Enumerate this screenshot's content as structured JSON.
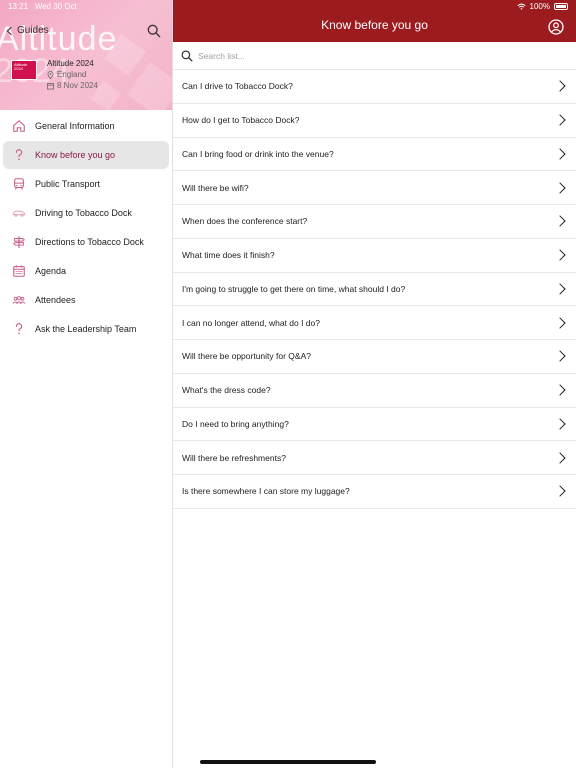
{
  "status": {
    "time": "13:21",
    "date": "Wed 30 Oct",
    "battery": "100%"
  },
  "sidebar": {
    "back_label": "Guides",
    "hero_word": "Altitude",
    "hero_year": "2024",
    "logo_text": "Altitude 2024",
    "event_name": "Altitude 2024",
    "event_location": "England",
    "event_date": "8 Nov 2024",
    "items": [
      {
        "label": "General Information",
        "icon": "home-icon"
      },
      {
        "label": "Know before you go",
        "icon": "question-icon",
        "active": true
      },
      {
        "label": "Public Transport",
        "icon": "bus-icon"
      },
      {
        "label": "Driving to Tobacco Dock",
        "icon": "car-icon"
      },
      {
        "label": "Directions to Tobacco Dock",
        "icon": "signpost-icon"
      },
      {
        "label": "Agenda",
        "icon": "calendar-icon"
      },
      {
        "label": "Attendees",
        "icon": "people-icon"
      },
      {
        "label": "Ask the Leadership Team",
        "icon": "question-icon"
      }
    ]
  },
  "main": {
    "title": "Know before you go",
    "search_placeholder": "Search list...",
    "questions": [
      "Can I drive to Tobacco Dock?",
      "How do I get to Tobacco Dock?",
      "Can I bring food or drink into the venue?",
      "Will there be wifi?",
      "When does the conference start?",
      "What time does it finish?",
      "I'm going to struggle to get there on time, what should I do?",
      "I can no longer attend, what do I do?",
      "Will there be opportunity for Q&A?",
      "What's the dress code?",
      "Do I need to bring anything?",
      "Will there be refreshments?",
      "Is there somewhere I can store my luggage?"
    ]
  },
  "colors": {
    "header": "#9b1b1f",
    "accent": "#d0114d",
    "active_text": "#8b1a4a"
  }
}
